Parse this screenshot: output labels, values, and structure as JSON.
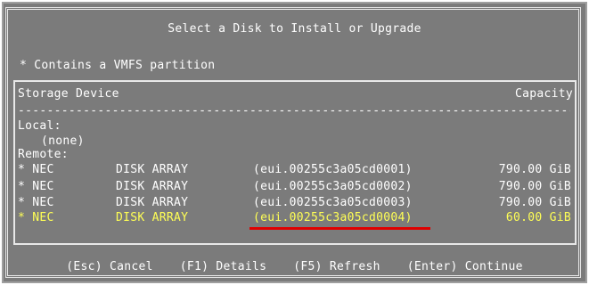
{
  "dialog": {
    "title": "Select a Disk to Install or Upgrade",
    "note": "* Contains a VMFS partition"
  },
  "table": {
    "header_device": "Storage Device",
    "header_capacity": "Capacity",
    "separator": "------------------------------------------------------------------------------------",
    "local_label": "Local:",
    "local_none": "(none)",
    "remote_label": "Remote:",
    "rows": [
      {
        "vendor": "* NEC",
        "model": "DISK ARRAY",
        "id": "(eui.00255c3a05cd0001)",
        "capacity": "790.00 GiB"
      },
      {
        "vendor": "* NEC",
        "model": "DISK ARRAY",
        "id": "(eui.00255c3a05cd0002)",
        "capacity": "790.00 GiB"
      },
      {
        "vendor": "* NEC",
        "model": "DISK ARRAY",
        "id": "(eui.00255c3a05cd0003)",
        "capacity": "790.00 GiB"
      },
      {
        "vendor": "* NEC",
        "model": "DISK ARRAY",
        "id": "(eui.00255c3a05cd0004)",
        "capacity": "60.00 GiB"
      }
    ],
    "selected_row": 3
  },
  "footer": {
    "cancel": "(Esc) Cancel",
    "details": "(F1) Details",
    "refresh": "(F5) Refresh",
    "continue": "(Enter) Continue"
  },
  "colors": {
    "panel_bg": "#7b7b7b",
    "text": "#ffffff",
    "selected_text": "#ffff55",
    "annotation_underline": "#e00000"
  }
}
